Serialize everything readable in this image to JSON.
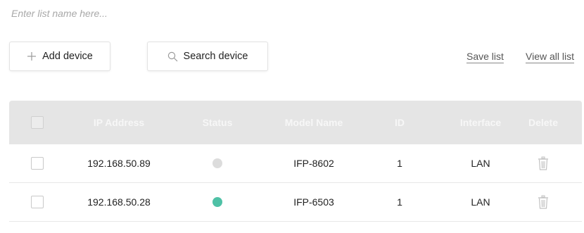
{
  "list_name": {
    "placeholder": "Enter list name here...",
    "value": ""
  },
  "toolbar": {
    "add_label": "Add device",
    "add_icon": "plus-icon",
    "search_label": "Search device",
    "search_icon": "search-icon",
    "save_label": "Save list",
    "view_all_label": "View all list"
  },
  "table": {
    "columns": [
      "IP Address",
      "Status",
      "Model Name",
      "ID",
      "Interface",
      "Delete"
    ],
    "rows": [
      {
        "checked": false,
        "ip": "192.168.50.89",
        "status": "offline",
        "status_color": "#dcdcdc",
        "model": "IFP-8602",
        "id": "1",
        "interface": "LAN",
        "delete_icon": "trash-icon"
      },
      {
        "checked": false,
        "ip": "192.168.50.28",
        "status": "online",
        "status_color": "#4fc1a6",
        "model": "IFP-6503",
        "id": "1",
        "interface": "LAN",
        "delete_icon": "trash-icon"
      }
    ]
  },
  "colors": {
    "header_bg": "#e5e5e5",
    "header_text": "#f7f7f7",
    "online": "#4fc1a6",
    "offline": "#dcdcdc"
  }
}
